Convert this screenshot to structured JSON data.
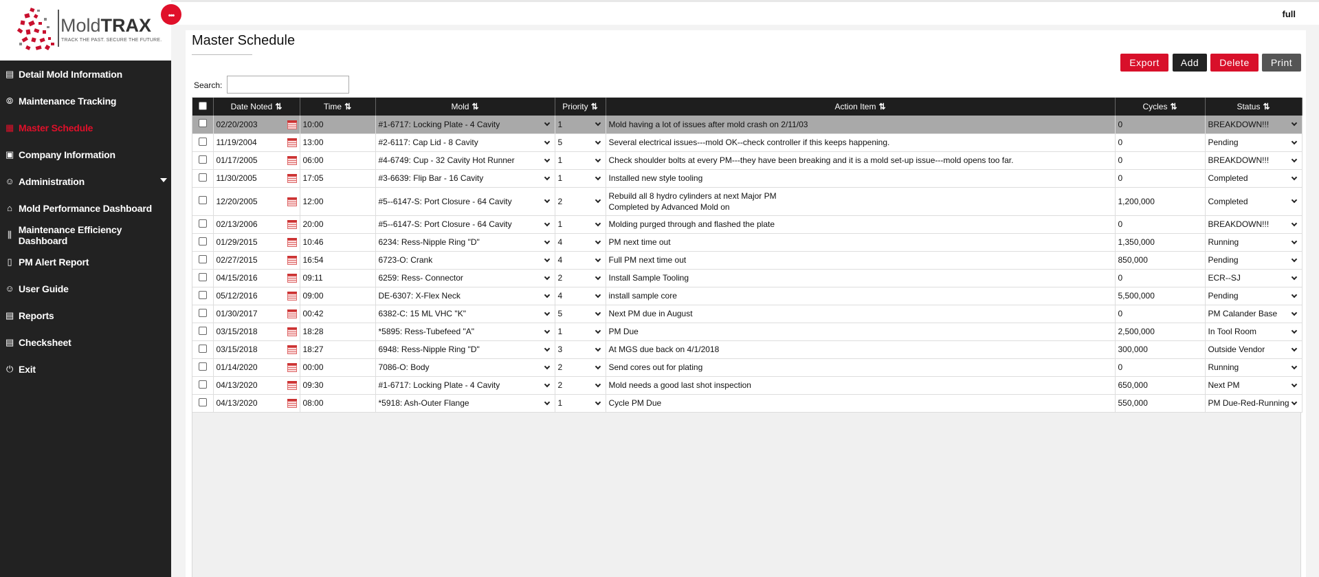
{
  "brand": {
    "logo_main": "Mold",
    "logo_bold": "TRAX",
    "tagline": "TRACK THE PAST. SECURE THE FUTURE.",
    "menu_dots": "•••",
    "accent_color": "#e0102a"
  },
  "sidebar": {
    "items": [
      {
        "label": "Detail Mold Information",
        "icon": "file-icon",
        "glyph": "▤"
      },
      {
        "label": "Maintenance Tracking",
        "icon": "compass-icon",
        "glyph": "⦾"
      },
      {
        "label": "Master Schedule",
        "icon": "calendar-icon",
        "glyph": "▦"
      },
      {
        "label": "Company Information",
        "icon": "id-card-icon",
        "glyph": "▣"
      },
      {
        "label": "Administration",
        "icon": "user-icon",
        "glyph": "☺"
      },
      {
        "label": "Mold Performance Dashboard",
        "icon": "home-icon",
        "glyph": "⌂"
      },
      {
        "label": "Maintenance Efficiency Dashboard",
        "icon": "sliders-icon",
        "glyph": "⫼"
      },
      {
        "label": "PM Alert Report",
        "icon": "clipboard-icon",
        "glyph": "▯"
      },
      {
        "label": "User Guide",
        "icon": "user-check-icon",
        "glyph": "☺"
      },
      {
        "label": "Reports",
        "icon": "report-icon",
        "glyph": "▤"
      },
      {
        "label": "Checksheet",
        "icon": "checklist-icon",
        "glyph": "▤"
      },
      {
        "label": "Exit",
        "icon": "power-icon",
        "glyph": "⏻"
      }
    ]
  },
  "topbar": {
    "label": "full"
  },
  "main": {
    "title": "Master Schedule",
    "buttons": {
      "export": "Export",
      "add": "Add",
      "delete": "Delete",
      "print": "Print"
    },
    "search_label": "Search:",
    "search_value": ""
  },
  "table": {
    "columns": [
      "Date Noted",
      "Time",
      "Mold",
      "Priority",
      "Action Item",
      "Cycles",
      "Status"
    ],
    "sort_glyph": "⇅",
    "rows": [
      {
        "date": "02/20/2003",
        "time": "10:00",
        "mold": "#1-6717: Locking Plate - 4 Cavity",
        "priority": "1",
        "action": "Mold having a lot of issues after mold crash on 2/11/03",
        "action2": "",
        "cycles": "0",
        "status": "BREAKDOWN!!!"
      },
      {
        "date": "11/19/2004",
        "time": "13:00",
        "mold": "#2-6117: Cap Lid - 8 Cavity",
        "priority": "5",
        "action": "Several electrical issues---mold OK--check controller if this keeps happening.",
        "action2": "",
        "cycles": "0",
        "status": "Pending"
      },
      {
        "date": "01/17/2005",
        "time": "06:00",
        "mold": "#4-6749: Cup - 32 Cavity Hot Runner",
        "priority": "1",
        "action": "Check shoulder bolts at every PM---they have been breaking and it is a mold set-up issue---mold opens too far.",
        "action2": "",
        "cycles": "0",
        "status": "BREAKDOWN!!!"
      },
      {
        "date": "11/30/2005",
        "time": "17:05",
        "mold": "#3-6639: Flip Bar - 16 Cavity",
        "priority": "1",
        "action": "Installed new style tooling",
        "action2": "",
        "cycles": "0",
        "status": "Completed"
      },
      {
        "date": "12/20/2005",
        "time": "12:00",
        "mold": "#5--6147-S: Port Closure - 64 Cavity",
        "priority": "2",
        "action": "Rebuild all 8 hydro cylinders at next Major PM",
        "action2": "Completed by Advanced Mold on",
        "cycles": "1,200,000",
        "status": "Completed"
      },
      {
        "date": "02/13/2006",
        "time": "20:00",
        "mold": "#5--6147-S: Port Closure - 64 Cavity",
        "priority": "1",
        "action": "Molding purged through and flashed the plate",
        "action2": "",
        "cycles": "0",
        "status": "BREAKDOWN!!!"
      },
      {
        "date": "01/29/2015",
        "time": "10:46",
        "mold": "6234: Ress-Nipple Ring \"D\"",
        "priority": "4",
        "action": "PM next time out",
        "action2": "",
        "cycles": "1,350,000",
        "status": "Running"
      },
      {
        "date": "02/27/2015",
        "time": "16:54",
        "mold": "6723-O: Crank",
        "priority": "4",
        "action": "Full PM next time out",
        "action2": "",
        "cycles": "850,000",
        "status": "Pending"
      },
      {
        "date": "04/15/2016",
        "time": "09:11",
        "mold": "6259: Ress- Connector",
        "priority": "2",
        "action": "Install Sample Tooling",
        "action2": "",
        "cycles": "0",
        "status": "ECR--SJ"
      },
      {
        "date": "05/12/2016",
        "time": "09:00",
        "mold": "DE-6307: X-Flex Neck",
        "priority": "4",
        "action": "install sample core",
        "action2": "",
        "cycles": "5,500,000",
        "status": "Pending"
      },
      {
        "date": "01/30/2017",
        "time": "00:42",
        "mold": "6382-C: 15 ML VHC \"K\"",
        "priority": "5",
        "action": "Next PM due in August",
        "action2": "",
        "cycles": "0",
        "status": "PM Calander Base"
      },
      {
        "date": "03/15/2018",
        "time": "18:28",
        "mold": "*5895: Ress-Tubefeed \"A\"",
        "priority": "1",
        "action": "PM Due",
        "action2": "",
        "cycles": "2,500,000",
        "status": "In Tool Room"
      },
      {
        "date": "03/15/2018",
        "time": "18:27",
        "mold": "6948: Ress-Nipple Ring \"D\"",
        "priority": "3",
        "action": "At MGS due back on 4/1/2018",
        "action2": "",
        "cycles": "300,000",
        "status": "Outside Vendor"
      },
      {
        "date": "01/14/2020",
        "time": "00:00",
        "mold": "7086-O: Body",
        "priority": "2",
        "action": "Send cores out for plating",
        "action2": "",
        "cycles": "0",
        "status": "Running"
      },
      {
        "date": "04/13/2020",
        "time": "09:30",
        "mold": "#1-6717: Locking Plate - 4 Cavity",
        "priority": "2",
        "action": "Mold needs a good last shot inspection",
        "action2": "",
        "cycles": "650,000",
        "status": "Next PM"
      },
      {
        "date": "04/13/2020",
        "time": "08:00",
        "mold": "*5918: Ash-Outer Flange",
        "priority": "1",
        "action": "Cycle PM Due",
        "action2": "",
        "cycles": "550,000",
        "status": "PM Due-Red-Running"
      }
    ]
  }
}
